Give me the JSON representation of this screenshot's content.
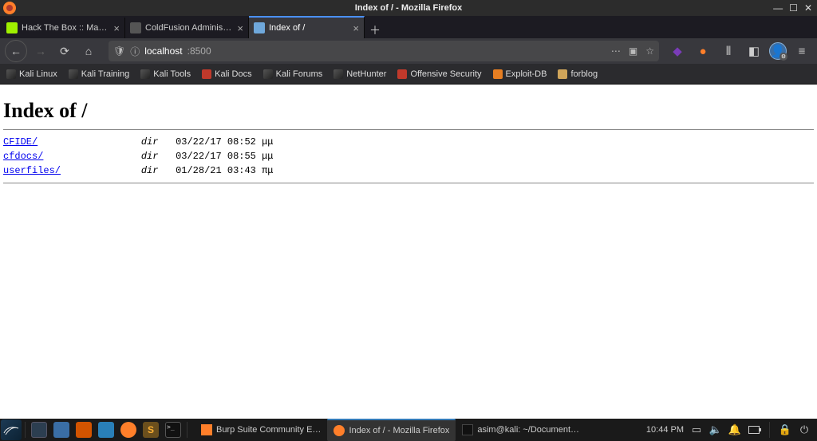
{
  "window": {
    "title": "Index of / - Mozilla Firefox"
  },
  "tabs": [
    {
      "label": "Hack The Box :: Machines"
    },
    {
      "label": "ColdFusion Administrato…"
    },
    {
      "label": "Index of /"
    }
  ],
  "address": {
    "host": "localhost",
    "port": ":8500"
  },
  "bookmarks": [
    {
      "label": "Kali Linux"
    },
    {
      "label": "Kali Training"
    },
    {
      "label": "Kali Tools"
    },
    {
      "label": "Kali Docs"
    },
    {
      "label": "Kali Forums"
    },
    {
      "label": "NetHunter"
    },
    {
      "label": "Offensive Security"
    },
    {
      "label": "Exploit-DB"
    },
    {
      "label": "forblog"
    }
  ],
  "page": {
    "heading": "Index of /",
    "rows": [
      {
        "name": "CFIDE/",
        "type": "dir",
        "date": "03/22/17 08:52 μμ"
      },
      {
        "name": "cfdocs/",
        "type": "dir",
        "date": "03/22/17 08:55 μμ"
      },
      {
        "name": "userfiles/",
        "type": "dir",
        "date": "01/28/21 03:43 πμ"
      }
    ]
  },
  "taskbar": {
    "items": [
      {
        "label": "Burp Suite Community E…"
      },
      {
        "label": "Index of / - Mozilla Firefox"
      },
      {
        "label": "asim@kali: ~/Document…"
      }
    ],
    "clock": "10:44 PM"
  }
}
